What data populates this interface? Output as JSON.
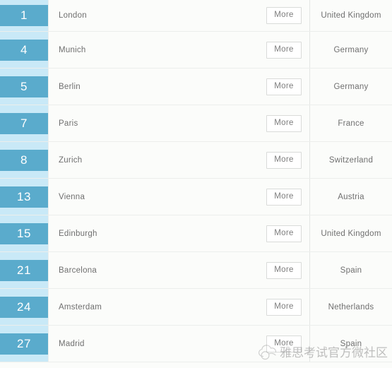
{
  "table": {
    "more_label": "More",
    "rows": [
      {
        "rank": "1",
        "city": "London",
        "country": "United Kingdom"
      },
      {
        "rank": "4",
        "city": "Munich",
        "country": "Germany"
      },
      {
        "rank": "5",
        "city": "Berlin",
        "country": "Germany"
      },
      {
        "rank": "7",
        "city": "Paris",
        "country": "France"
      },
      {
        "rank": "8",
        "city": "Zurich",
        "country": "Switzerland"
      },
      {
        "rank": "13",
        "city": "Vienna",
        "country": "Austria"
      },
      {
        "rank": "15",
        "city": "Edinburgh",
        "country": "United Kingdom"
      },
      {
        "rank": "21",
        "city": "Barcelona",
        "country": "Spain"
      },
      {
        "rank": "24",
        "city": "Amsterdam",
        "country": "Netherlands"
      },
      {
        "rank": "27",
        "city": "Madrid",
        "country": "Spain"
      }
    ]
  },
  "watermark": {
    "text": "雅思考试官方微社区",
    "logo_icon": "cloud-outline-icon"
  },
  "colors": {
    "rank_column_bg": "#c9e9f7",
    "rank_block_bg": "#5aabcc",
    "rank_text": "#ffffff",
    "row_bg": "#fbfcfa",
    "row_border": "#eceeec",
    "body_text": "#6f6f6f",
    "button_border": "#d9dbd9"
  }
}
